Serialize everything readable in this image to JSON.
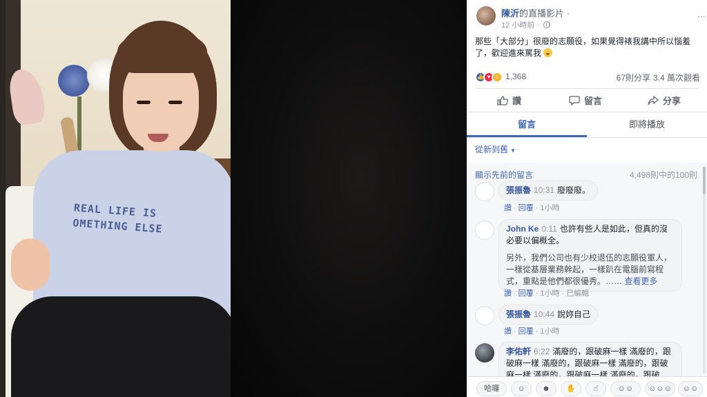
{
  "post": {
    "page_name": "陳沂",
    "title_suffix": "的直播影片",
    "dot": "·",
    "time": "12 小時前",
    "time_dot": "·",
    "menu": "···",
    "text": "那些「大部分」很廢的志願役，如果覺得裱我講中所以惱羞了，歡迎進來罵我",
    "emoji": "kissing-heart-emoji"
  },
  "video": {
    "sweater_line1": "REAL LIFE IS",
    "sweater_line2": "OMETHING ELSE"
  },
  "stats": {
    "reaction_count": "1,368",
    "shares": "67則分享",
    "views": "3.4 萬次觀看",
    "reactions": [
      "like",
      "love",
      "haha"
    ]
  },
  "actions": {
    "like": "讚",
    "comment": "留言",
    "share": "分享"
  },
  "tabs": {
    "comments": "留言",
    "up_next": "即將播放"
  },
  "sort": {
    "label": "從新到舊"
  },
  "comments_header": {
    "show_previous": "顯示先前的留言",
    "count": "4,498則中的100則"
  },
  "comments": [
    {
      "name": "張振魯",
      "time": "10:31",
      "text": "廢廢廢。",
      "like": "讚",
      "reply": "回覆",
      "age": "1小時"
    },
    {
      "name": "John Ke",
      "time": "0:11",
      "text1": "也許有些人是如此，但真的沒必要以偏概全。",
      "text2": "另外，我們公司也有少校退伍的志願役軍人，一樣從基層業務幹起，一樣趴在電腦前寫程式，重點是他們都很優秀。……",
      "see_more": "查看更多",
      "like": "讚",
      "reply": "回覆",
      "age": "1小時",
      "edited": "已編輯"
    },
    {
      "name": "張振魯",
      "time": "10:44",
      "text": "說妳自己",
      "like": "讚",
      "reply": "回覆",
      "age": "1小時"
    },
    {
      "name": "李佑軒",
      "time": "6:22",
      "text": "滿廢的，跟破麻一樣 滿廢的，跟破麻一樣 滿廢的，跟破麻一樣 滿廢的，跟破麻一樣 滿廢的，跟破麻一樣 滿廢的，跟破"
    }
  ],
  "reaction_bar": {
    "first": "哈囉"
  }
}
